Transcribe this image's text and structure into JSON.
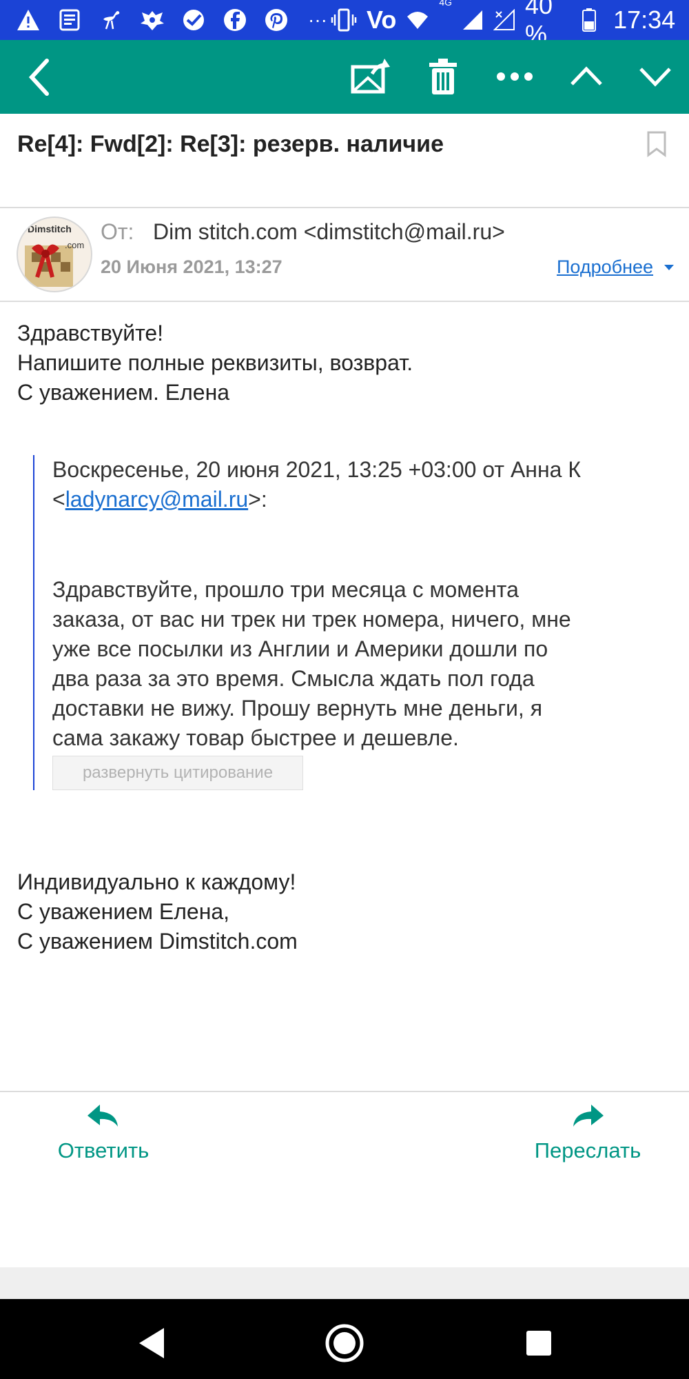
{
  "status_bar": {
    "network": "Vo",
    "network_type": "4G",
    "battery": "40 %",
    "time": "17:34"
  },
  "toolbar": {
    "back": "back",
    "actions": [
      "mark-unread",
      "delete",
      "more",
      "previous",
      "next"
    ]
  },
  "email": {
    "subject": "Re[4]: Fwd[2]: Re[3]: резерв. наличие",
    "avatar_text": "Dimstitch",
    "avatar_sub": ".com",
    "from_label": "От:",
    "from_value": "Dim stitch.com <dimstitch@mail.ru>",
    "date": "20 Июня 2021, 13:27",
    "details_label": "Подробнее",
    "body_lines": [
      "Здравствуйте!",
      "Напишите полные реквизиты, возврат.",
      "С уважением. Елена"
    ],
    "quote_header_1": "Воскресенье, 20 июня 2021, 13:25 +03:00 от Анна К",
    "quote_header_open": "<",
    "quote_email": "ladynarcy@mail.ru",
    "quote_header_close": ">:",
    "quote_lines": [
      "Здравствуйте, прошло три месяца с момента",
      "заказа, от вас ни трек ни трек номера, ничего, мне",
      "уже все посылки из Англии и Америки дошли по",
      "два раза за это время. Смысла ждать пол года",
      "доставки не вижу. Прошу вернуть мне деньги, я",
      "сама закажу товар быстрее и дешевле."
    ],
    "expand_quote_label": "развернуть цитирование",
    "signature_lines": [
      "Индивидуально к каждому!",
      "С уважением Елена,",
      "С уважением Dimstitch.com"
    ]
  },
  "actions": {
    "reply_label": "Ответить",
    "forward_label": "Переслать"
  },
  "colors": {
    "status_bar": "#1b43d6",
    "toolbar": "#009684",
    "link": "#1a6fd0",
    "action": "#009684"
  }
}
